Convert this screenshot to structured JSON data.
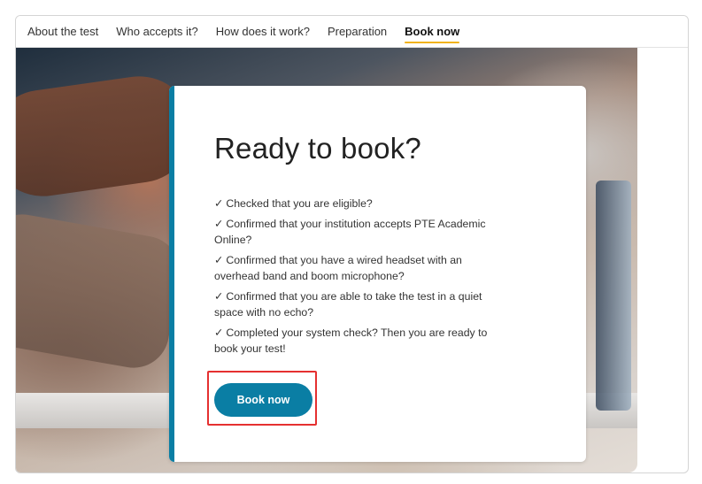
{
  "nav": {
    "items": [
      {
        "label": "About the test",
        "active": false
      },
      {
        "label": "Who accepts it?",
        "active": false
      },
      {
        "label": "How does it work?",
        "active": false
      },
      {
        "label": "Preparation",
        "active": false
      },
      {
        "label": "Book now",
        "active": true
      }
    ]
  },
  "card": {
    "title": "Ready to book?",
    "check_mark": "✓",
    "checklist": [
      "Checked that you are eligible?",
      "Confirmed that your institution accepts PTE Academic Online?",
      "Confirmed that you have a wired headset with an overhead band and boom microphone?",
      "Confirmed that you are able to take the test in a quiet space with no echo?",
      "Completed your system check? Then you are ready to book your test!"
    ],
    "button_label": "Book now"
  },
  "colors": {
    "accent": "#0a7ea4",
    "nav_underline": "#f2b31a",
    "highlight": "#e53030"
  }
}
